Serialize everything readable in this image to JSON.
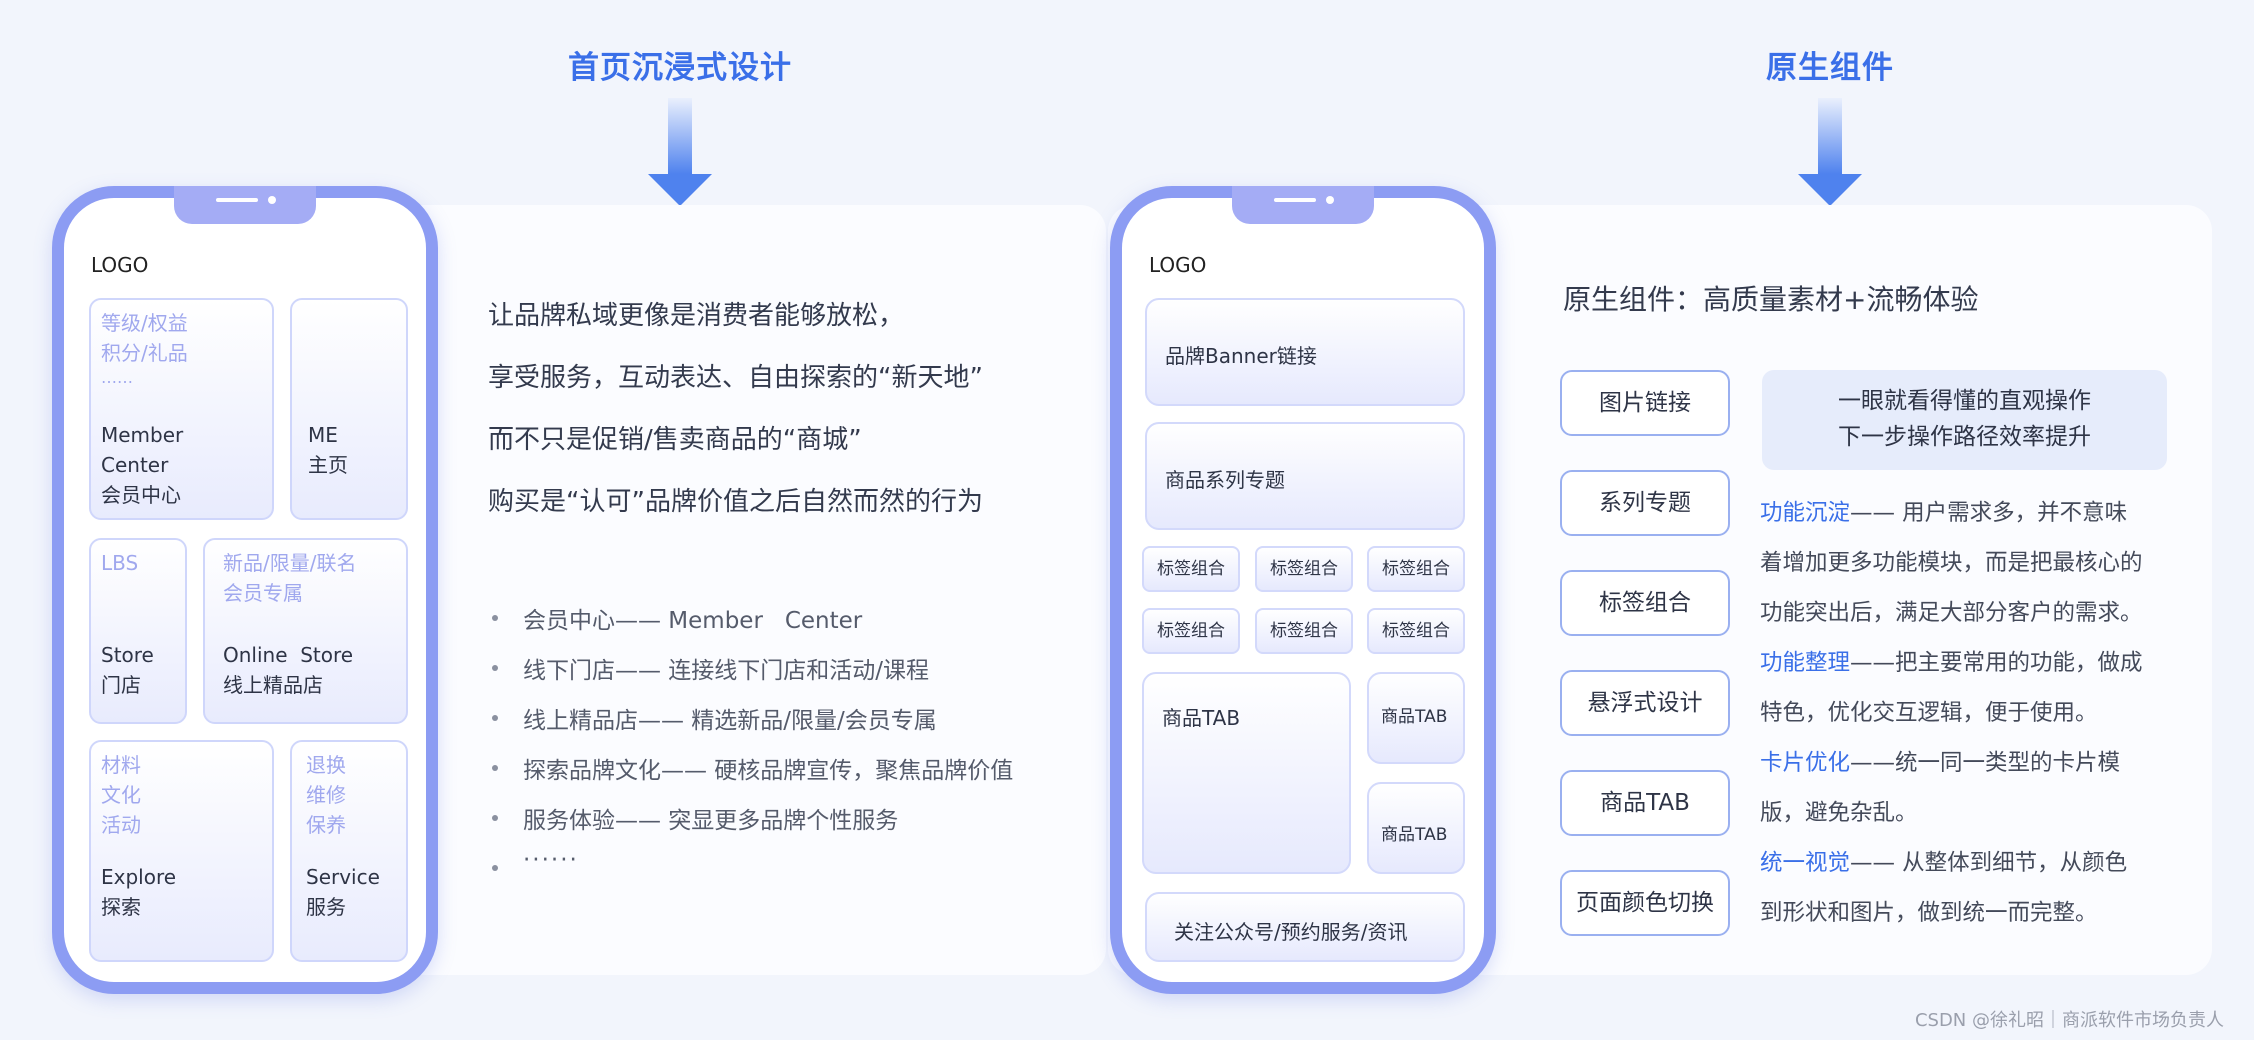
{
  "left": {
    "title": "首页沉浸式设计",
    "logo": "LOGO",
    "cards": [
      {
        "faint": [
          "等级/权益",
          "积分/礼品",
          "……"
        ],
        "main": [
          "Member",
          "Center",
          "会员中心"
        ]
      },
      {
        "faint": [],
        "main": [
          "ME",
          "主页"
        ]
      },
      {
        "faint": [
          "LBS"
        ],
        "main": [
          "Store",
          "门店"
        ]
      },
      {
        "faint": [
          "新品/限量/联名",
          "会员专属"
        ],
        "main": [
          "Online  Store",
          "线上精品店"
        ]
      },
      {
        "faint": [
          "材料",
          "文化",
          "活动"
        ],
        "main": [
          "Explore",
          "探索"
        ]
      },
      {
        "faint": [
          "退换",
          "维修",
          "保养"
        ],
        "main": [
          "Service",
          "服务"
        ]
      }
    ],
    "paragraph": [
      "让品牌私域更像是消费者能够放松，",
      "享受服务，互动表达、自由探索的“新天地”",
      "而不只是促销/售卖商品的“商城”",
      "购买是“认可”品牌价值之后自然而然的行为"
    ],
    "bullets": [
      "会员中心—— Member   Center",
      "线下门店—— 连接线下门店和活动/课程",
      "线上精品店—— 精选新品/限量/会员专属",
      "探索品牌文化—— 硬核品牌宣传，聚焦品牌价值",
      "服务体验—— 突显更多品牌个性服务",
      "······"
    ]
  },
  "right": {
    "title": "原生组件",
    "logo": "LOGO",
    "phone": {
      "banner": "品牌Banner链接",
      "series": "商品系列专题",
      "tags": [
        "标签组合",
        "标签组合",
        "标签组合",
        "标签组合",
        "标签组合",
        "标签组合"
      ],
      "tab_big": "商品TAB",
      "tab_small_1": "商品TAB",
      "tab_small_2": "商品TAB",
      "bottom": "关注公众号/预约服务/资讯"
    },
    "headline": "原生组件：高质量素材+流畅体验",
    "pills": [
      "图片链接",
      "系列专题",
      "标签组合",
      "悬浮式设计",
      "商品TAB",
      "页面颜色切换"
    ],
    "info_box": [
      "一眼就看得懂的直观操作",
      "下一步操作路径效率提升"
    ],
    "desc": [
      {
        "hl": "功能沉淀",
        "text": "—— 用户需求多，并不意味"
      },
      {
        "hl": "",
        "text": "着增加更多功能模块，而是把最核心的"
      },
      {
        "hl": "",
        "text": "功能突出后，满足大部分客户的需求。"
      },
      {
        "hl": "功能整理",
        "text": "——把主要常用的功能，做成"
      },
      {
        "hl": "",
        "text": "特色，优化交互逻辑，便于使用。"
      },
      {
        "hl": "卡片优化",
        "text": "——统一同一类型的卡片模"
      },
      {
        "hl": "",
        "text": "版，避免杂乱。"
      },
      {
        "hl": "统一视觉",
        "text": "—— 从整体到细节，从颜色"
      },
      {
        "hl": "",
        "text": "到形状和图片，做到统一而完整。"
      }
    ]
  },
  "footer": "CSDN @徐礼昭｜商派软件市场负责人",
  "colors": {
    "accent": "#3a6fe8",
    "phone_frame": "#8c9cf3",
    "card_bg": "#e8ebfd"
  }
}
